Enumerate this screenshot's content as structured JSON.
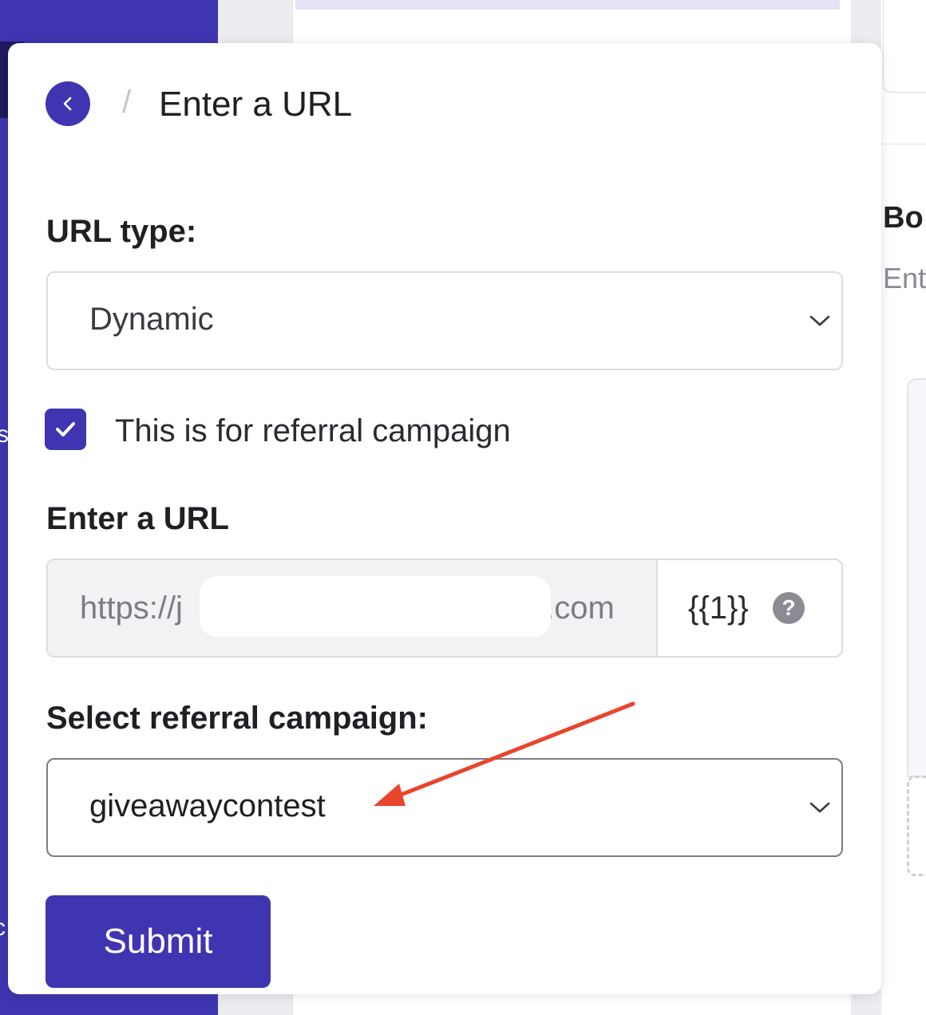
{
  "background": {
    "sidebar_glyph_1": "s",
    "sidebar_glyph_2": "c",
    "right_heading": "Bo",
    "right_sub": "Ent"
  },
  "popover": {
    "breadcrumb_separator": "/",
    "title": "Enter a URL",
    "url_type": {
      "label": "URL type:",
      "selected": "Dynamic"
    },
    "referral_checkbox": {
      "checked": true,
      "label": "This is for referral campaign"
    },
    "url_field": {
      "label": "Enter a URL",
      "prefix": "https://j",
      "suffix": "t.com",
      "variable": "{{1}}",
      "help_glyph": "?"
    },
    "referral_campaign": {
      "label": "Select referral campaign:",
      "selected": "giveawaycontest"
    },
    "submit_label": "Submit"
  },
  "colors": {
    "accent": "#3f35b1",
    "annotation_arrow": "#e8452c"
  },
  "icons": {
    "back": "chevron-left-icon",
    "dropdown": "chevron-down-icon",
    "checkbox": "checkmark-icon",
    "help": "question-circle-icon"
  }
}
